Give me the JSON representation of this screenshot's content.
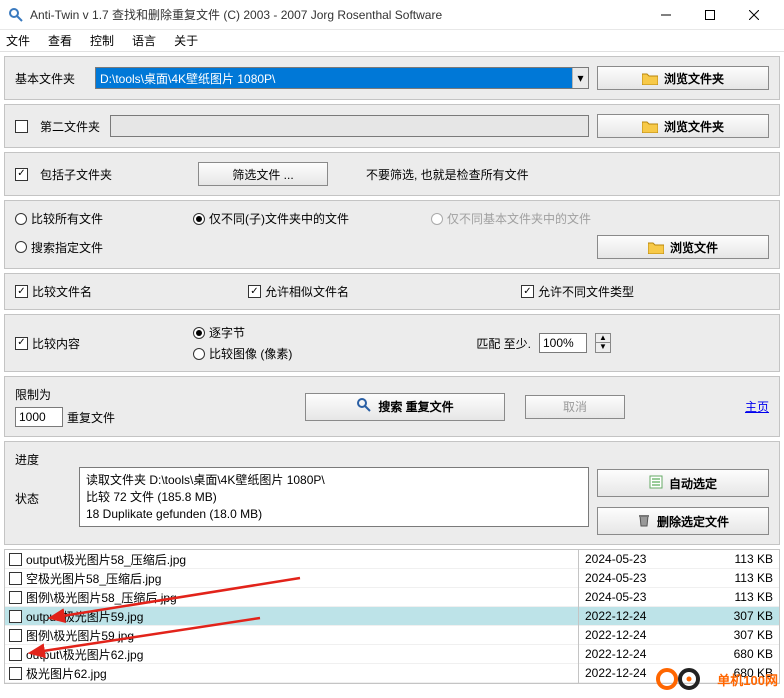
{
  "title": "Anti-Twin   v 1.7   查找和删除重复文件   (C) 2003 - 2007  Jorg Rosenthal Software",
  "menu": {
    "file": "文件",
    "view": "查看",
    "ctrl": "控制",
    "lang": "语言",
    "about": "关于"
  },
  "sec1": {
    "label": "基本文件夹",
    "path": "D:\\tools\\桌面\\4K壁纸图片 1080P\\",
    "browse": "浏览文件夹"
  },
  "sec2": {
    "label": "第二文件夹",
    "browse": "浏览文件夹"
  },
  "sec3": {
    "include": "包括子文件夹",
    "filter": "筛选文件 ...",
    "note": "不要筛选, 也就是检查所有文件"
  },
  "sec4": {
    "all": "比较所有文件",
    "subonly": "仅不同(子)文件夹中的文件",
    "baseonly": "仅不同基本文件夹中的文件",
    "specify": "搜索指定文件",
    "browse": "浏览文件"
  },
  "sec5": {
    "cmpname": "比较文件名",
    "similar": "允许相似文件名",
    "difftype": "允许不同文件类型"
  },
  "sec6": {
    "cmpcontent": "比较内容",
    "bybyte": "逐字节",
    "byimg": "比较图像 (像素)",
    "match": "匹配 至少.",
    "pct": "100%"
  },
  "sec7": {
    "limit": "限制为",
    "val": "1000",
    "dup": "重复文件",
    "search": "搜索 重复文件",
    "cancel": "取消",
    "home": "主页"
  },
  "sec8": {
    "progress": "进度",
    "status": "状态",
    "l1": "读取文件夹  D:\\tools\\桌面\\4K壁纸图片 1080P\\",
    "l2": "比较 72 文件        (185.8 MB)",
    "l3": "18 Duplikate gefunden (18.0 MB)",
    "auto": "自动选定",
    "del": "删除选定文件"
  },
  "files": [
    {
      "name": "output\\极光图片58_压缩后.jpg",
      "date": "2024-05-23",
      "size": "113 KB",
      "chk": false,
      "sel": false
    },
    {
      "name": "空极光图片58_压缩后.jpg",
      "date": "2024-05-23",
      "size": "113 KB",
      "chk": false,
      "sel": false
    },
    {
      "name": "图例\\极光图片58_压缩后.jpg",
      "date": "2024-05-23",
      "size": "113 KB",
      "chk": false,
      "sel": false
    },
    {
      "name": "output\\极光图片59.jpg",
      "date": "2022-12-24",
      "size": "307 KB",
      "chk": false,
      "sel": true
    },
    {
      "name": "图例\\极光图片59.jpg",
      "date": "2022-12-24",
      "size": "307 KB",
      "chk": false,
      "sel": false
    },
    {
      "name": "output\\极光图片62.jpg",
      "date": "2022-12-24",
      "size": "680 KB",
      "chk": false,
      "sel": false
    },
    {
      "name": "极光图片62.jpg",
      "date": "2022-12-24",
      "size": "680 KB",
      "chk": false,
      "sel": false
    }
  ],
  "watermark": "单机100网"
}
